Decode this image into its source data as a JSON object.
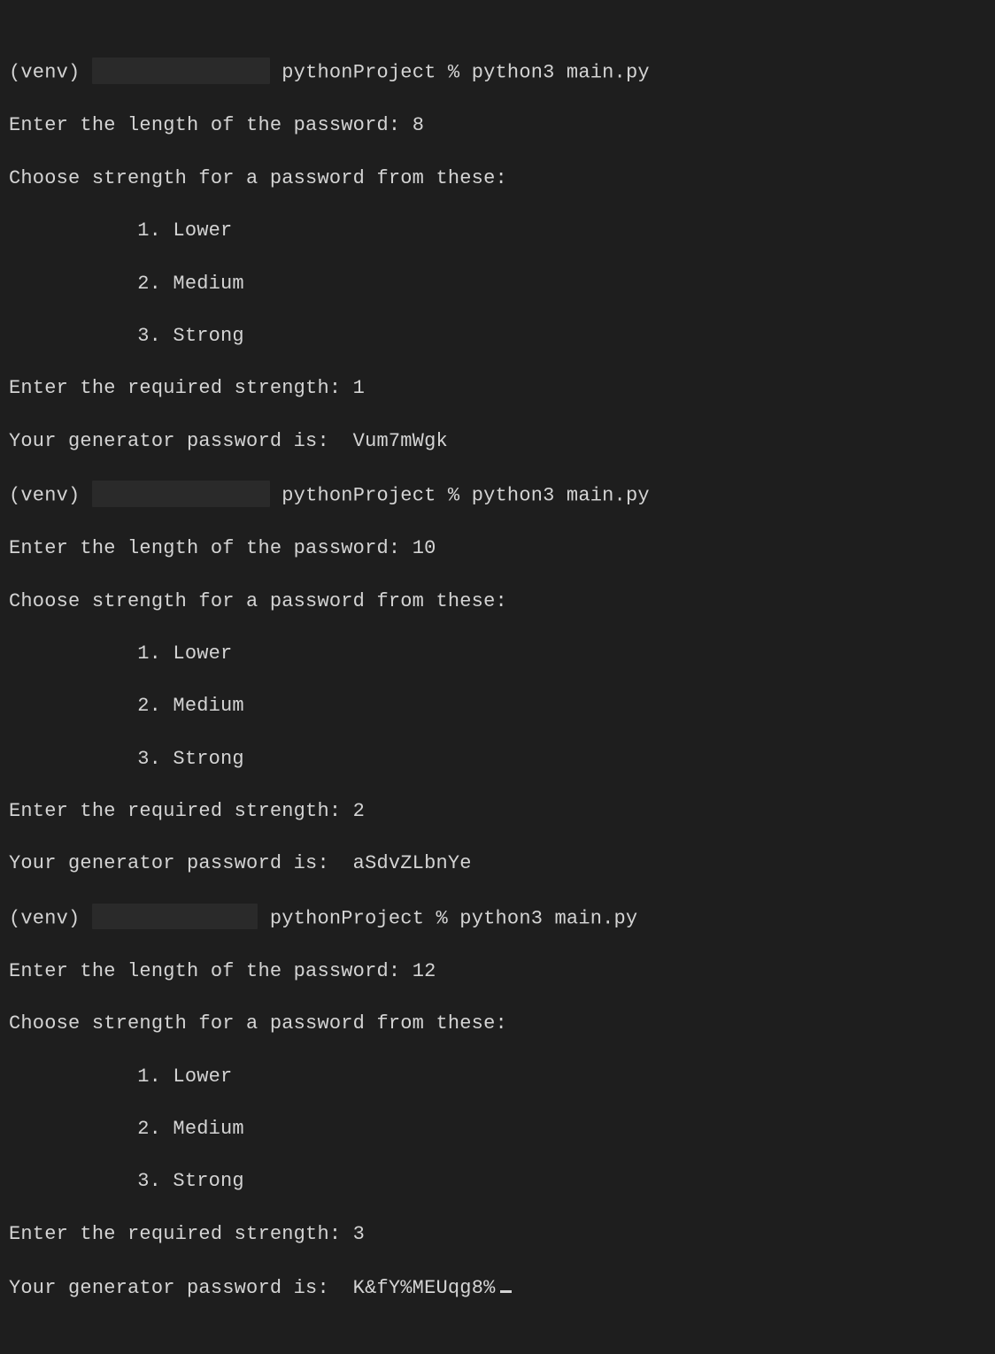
{
  "prompt": {
    "venv": "(venv) ",
    "redacted": "               ",
    "redacted3": "              ",
    "tail": " pythonProject % python3 main.py"
  },
  "labels": {
    "length_prompt": "Enter the length of the password: ",
    "choose": "Choose strength for a password from these:",
    "opt1": "1. Lower",
    "opt2": "2. Medium",
    "opt3": "3. Strong",
    "strength_prompt": "Enter the required strength: ",
    "result_label": "Your generator password is:  "
  },
  "runs": [
    {
      "length": "8",
      "strength": "1",
      "password": "Vum7mWgk"
    },
    {
      "length": "10",
      "strength": "2",
      "password": "aSdvZLbnYe"
    },
    {
      "length": "12",
      "strength": "3",
      "password": "K&fY%MEUqg8%"
    }
  ]
}
